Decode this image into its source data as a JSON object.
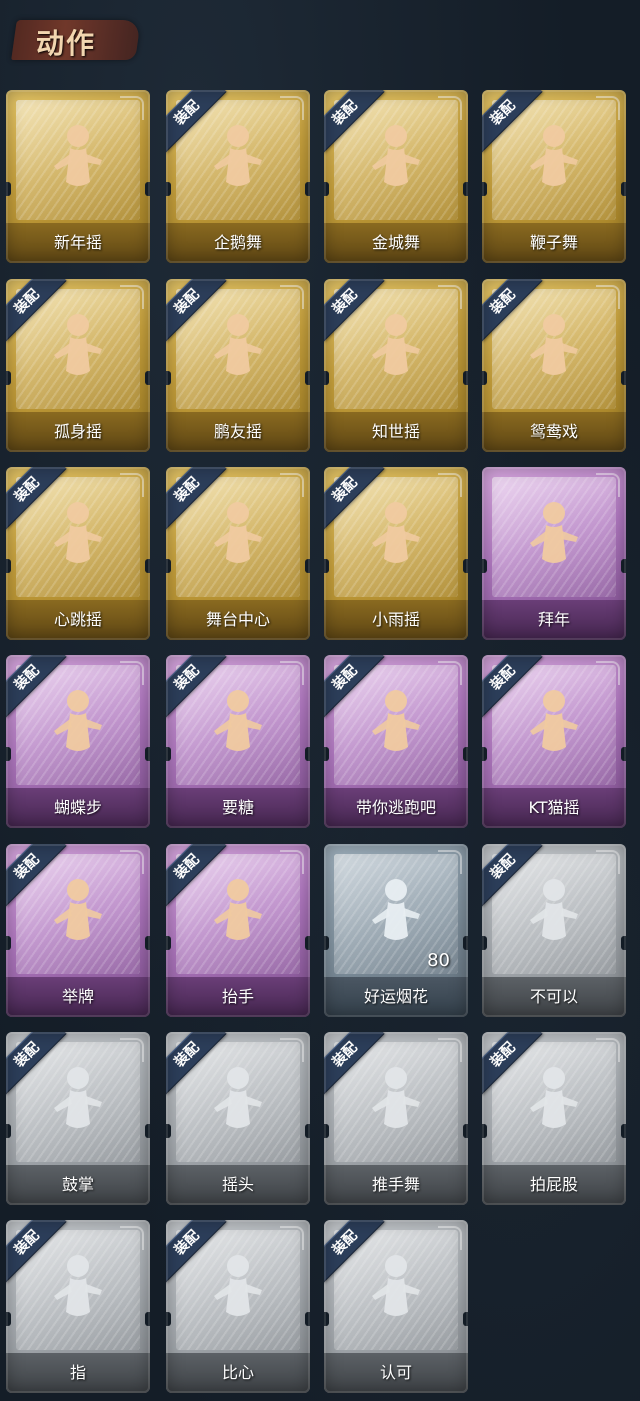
{
  "header": {
    "title": "动作"
  },
  "equip_label": "装配",
  "items": [
    {
      "label": "新年摇",
      "tier": "gold",
      "equipped": false,
      "count": ""
    },
    {
      "label": "企鹅舞",
      "tier": "gold",
      "equipped": true,
      "count": ""
    },
    {
      "label": "金城舞",
      "tier": "gold",
      "equipped": true,
      "count": ""
    },
    {
      "label": "鞭子舞",
      "tier": "gold",
      "equipped": true,
      "count": ""
    },
    {
      "label": "孤身摇",
      "tier": "gold",
      "equipped": true,
      "count": ""
    },
    {
      "label": "鹏友摇",
      "tier": "gold",
      "equipped": true,
      "count": ""
    },
    {
      "label": "知世摇",
      "tier": "gold",
      "equipped": true,
      "count": ""
    },
    {
      "label": "鸳鸯戏",
      "tier": "gold",
      "equipped": true,
      "count": ""
    },
    {
      "label": "心跳摇",
      "tier": "gold",
      "equipped": true,
      "count": ""
    },
    {
      "label": "舞台中心",
      "tier": "gold",
      "equipped": true,
      "count": ""
    },
    {
      "label": "小雨摇",
      "tier": "gold",
      "equipped": true,
      "count": ""
    },
    {
      "label": "拜年",
      "tier": "purple",
      "equipped": false,
      "count": ""
    },
    {
      "label": "蝴蝶步",
      "tier": "purple",
      "equipped": true,
      "count": ""
    },
    {
      "label": "要糖",
      "tier": "purple",
      "equipped": true,
      "count": ""
    },
    {
      "label": "带你逃跑吧",
      "tier": "purple",
      "equipped": true,
      "count": ""
    },
    {
      "label": "KT猫摇",
      "tier": "purple",
      "equipped": true,
      "count": ""
    },
    {
      "label": "举牌",
      "tier": "purple",
      "equipped": true,
      "count": ""
    },
    {
      "label": "抬手",
      "tier": "purple",
      "equipped": true,
      "count": ""
    },
    {
      "label": "好运烟花",
      "tier": "blue",
      "equipped": false,
      "count": "80"
    },
    {
      "label": "不可以",
      "tier": "grey",
      "equipped": true,
      "count": ""
    },
    {
      "label": "鼓掌",
      "tier": "grey",
      "equipped": true,
      "count": ""
    },
    {
      "label": "摇头",
      "tier": "grey",
      "equipped": true,
      "count": ""
    },
    {
      "label": "推手舞",
      "tier": "grey",
      "equipped": true,
      "count": ""
    },
    {
      "label": "拍屁股",
      "tier": "grey",
      "equipped": true,
      "count": ""
    },
    {
      "label": "指",
      "tier": "grey",
      "equipped": true,
      "count": ""
    },
    {
      "label": "比心",
      "tier": "grey",
      "equipped": true,
      "count": ""
    },
    {
      "label": "认可",
      "tier": "grey",
      "equipped": true,
      "count": ""
    }
  ],
  "colors": {
    "gold": "#c6a03c",
    "purple": "#b078c0",
    "blue": "#7f909d",
    "grey": "#a6abb0",
    "ribbon": "#2c3e5a",
    "background": "#16202b"
  }
}
